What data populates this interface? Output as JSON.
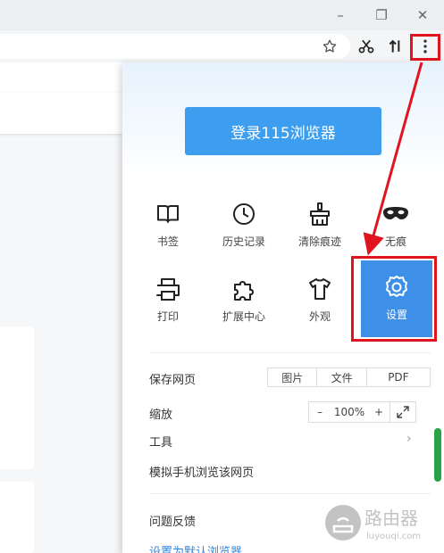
{
  "window_controls": {
    "minimize": "–",
    "restore": "❐",
    "close": "✕"
  },
  "toolbar": {
    "star_icon": "star-icon",
    "cut_icon": "scissors-icon",
    "sort_icon": "transfer-icon",
    "menu_icon": "more-vertical-icon"
  },
  "menu": {
    "login_label": "登录115浏览器",
    "grid": [
      {
        "label": "书签",
        "icon": "book-icon"
      },
      {
        "label": "历史记录",
        "icon": "clock-icon"
      },
      {
        "label": "清除痕迹",
        "icon": "broom-icon"
      },
      {
        "label": "无痕",
        "icon": "mask-icon"
      },
      {
        "label": "打印",
        "icon": "printer-icon"
      },
      {
        "label": "扩展中心",
        "icon": "puzzle-icon"
      },
      {
        "label": "外观",
        "icon": "shirt-icon"
      },
      {
        "label": "设置",
        "icon": "gear-icon"
      }
    ],
    "save_page": {
      "label": "保存网页",
      "options": [
        "图片",
        "文件",
        "PDF"
      ]
    },
    "zoom": {
      "label": "缩放",
      "minus": "–",
      "value": "100%",
      "plus": "+"
    },
    "tools_label": "工具",
    "mobile_label": "模拟手机浏览该网页",
    "feedback_label": "问题反馈",
    "default_browser_label": "设置为默认浏览器"
  },
  "watermark": {
    "title": "路由器",
    "subtitle": "luyouqi.com"
  },
  "colors": {
    "accent": "#3d9ef0",
    "settings_bg": "#3d8fe8",
    "annotation": "#e0141e",
    "side_tab": "#5b64c2"
  }
}
